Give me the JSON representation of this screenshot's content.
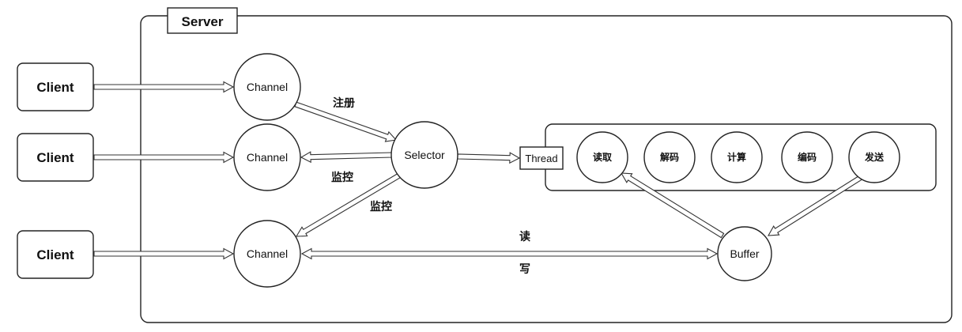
{
  "server": {
    "title": "Server"
  },
  "clients": [
    {
      "label": "Client"
    },
    {
      "label": "Client"
    },
    {
      "label": "Client"
    }
  ],
  "channels": [
    {
      "label": "Channel"
    },
    {
      "label": "Channel"
    },
    {
      "label": "Channel"
    }
  ],
  "selector": {
    "label": "Selector"
  },
  "thread": {
    "label": "Thread"
  },
  "steps": [
    {
      "label": "读取"
    },
    {
      "label": "解码"
    },
    {
      "label": "计算"
    },
    {
      "label": "编码"
    },
    {
      "label": "发送"
    }
  ],
  "buffer": {
    "label": "Buffer"
  },
  "edges": {
    "register": "注册",
    "monitor_1": "监控",
    "monitor_2": "监控",
    "read": "读",
    "write": "写"
  }
}
